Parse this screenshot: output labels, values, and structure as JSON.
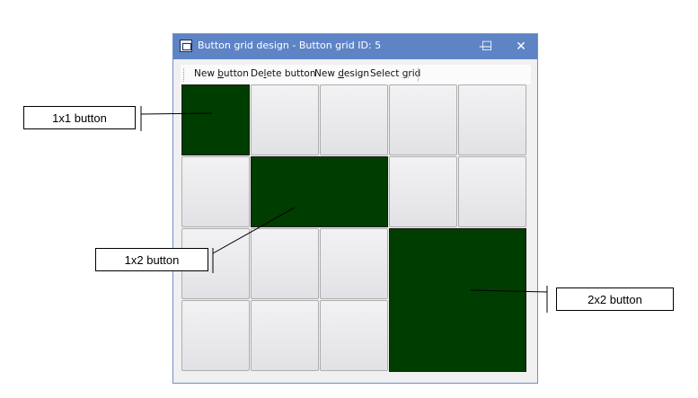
{
  "window": {
    "title": "Button grid design - Button grid ID: 5",
    "controls": {
      "minimize": "—",
      "maximize": "☐",
      "close": "✕"
    }
  },
  "menu": {
    "items": [
      {
        "prefix": "New ",
        "underline": "b",
        "suffix": "utton"
      },
      {
        "prefix": "De",
        "underline": "l",
        "suffix": "ete button"
      },
      {
        "prefix": "New ",
        "underline": "d",
        "suffix": "esign"
      },
      {
        "prefix": "Select ",
        "underline": "g",
        "suffix": "rid"
      }
    ]
  },
  "grid": {
    "rows": 4,
    "cols": 5,
    "colors": {
      "button": "#e8e8ec",
      "active": "#003d00"
    }
  },
  "annotations": {
    "label_1x1": "1x1 button",
    "label_1x2": "1x2 button",
    "label_2x2": "2x2 button"
  }
}
